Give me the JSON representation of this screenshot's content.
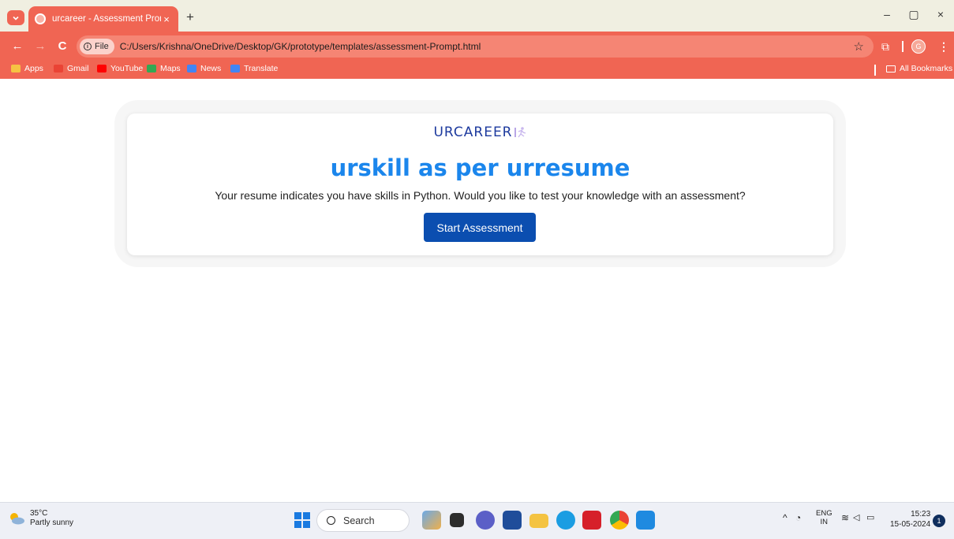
{
  "browser": {
    "tab": {
      "title": "urcareer - Assessment Prompt",
      "close": "×"
    },
    "new_tab": "+",
    "window_controls": {
      "minimize": "–",
      "restore": "▢",
      "close": "×"
    },
    "nav": {
      "back": "←",
      "forward": "→",
      "reload": "C"
    },
    "omnibox": {
      "chip": "File",
      "url": "C:/Users/Krishna/OneDrive/Desktop/GK/prototype/templates/assessment-Prompt.html"
    },
    "profile_initial": "G",
    "bookmarks": [
      {
        "label": "Apps",
        "icon": "apps-grid-icon",
        "color": "#f6c343"
      },
      {
        "label": "Gmail",
        "icon": "gmail-icon",
        "color": "#ea4335"
      },
      {
        "label": "YouTube",
        "icon": "youtube-icon",
        "color": "#ff0000"
      },
      {
        "label": "Maps",
        "icon": "maps-icon",
        "color": "#34a853"
      },
      {
        "label": "News",
        "icon": "news-icon",
        "color": "#4285f4"
      },
      {
        "label": "Translate",
        "icon": "translate-icon",
        "color": "#4285f4"
      }
    ],
    "all_bookmarks": "All Bookmarks"
  },
  "page": {
    "logo": "URCAREER",
    "headline": "urskill as per urresume",
    "prompt": "Your resume indicates you have skills in Python. Would you like to test your knowledge with an assessment?",
    "start_button": "Start Assessment"
  },
  "taskbar": {
    "weather": {
      "temp": "35°C",
      "condition": "Partly sunny"
    },
    "search_label": "Search",
    "language": {
      "line1": "ENG",
      "line2": "IN"
    },
    "time": "15:23",
    "date": "15-05-2024",
    "notifications": "1"
  },
  "colors": {
    "chrome_accent": "#f06553",
    "headline": "#1b86ec",
    "button": "#0b4eb0",
    "logo": "#1d3a9e"
  }
}
